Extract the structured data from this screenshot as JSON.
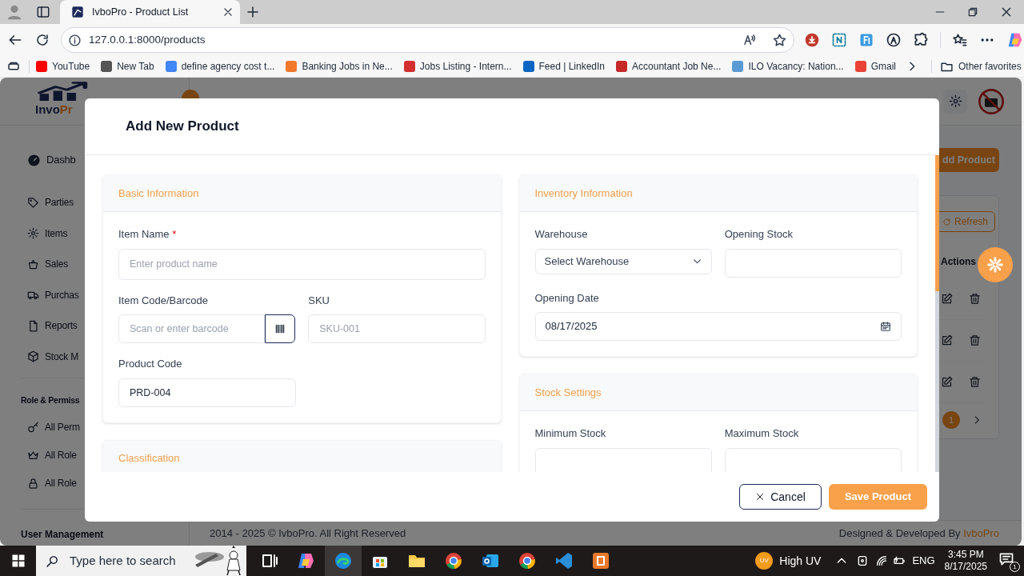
{
  "browser": {
    "tab_title": "IvboPro - Product List",
    "url": "127.0.0.1:8000/products",
    "bookmarks": [
      {
        "label": "YouTube",
        "color": "#ff0000"
      },
      {
        "label": "New Tab",
        "color": "#555555"
      },
      {
        "label": "define agency cost t...",
        "color": "#4285f4"
      },
      {
        "label": "Banking Jobs in Ne...",
        "color": "#f07a2a"
      },
      {
        "label": "Jobs Listing - Intern...",
        "color": "#d32f2f"
      },
      {
        "label": "Feed | LinkedIn",
        "color": "#0a66c2"
      },
      {
        "label": "Accountant Job Ne...",
        "color": "#c62828"
      },
      {
        "label": "ILO Vacancy: Nation...",
        "color": "#5b9bd5"
      },
      {
        "label": "Gmail",
        "color": "#ea4335"
      }
    ],
    "other_favorites": "Other favorites"
  },
  "app": {
    "logo": {
      "dark": "Invo",
      "accent": "Pr"
    },
    "sidebar": {
      "items": [
        "Dashb",
        "Parties",
        "Items",
        "Sales",
        "Purchas",
        "Reports",
        "Stock M"
      ],
      "section": {
        "title": "Role & Permiss",
        "items": [
          "All Perm",
          "All Role",
          "All Role"
        ]
      },
      "next_section": "User Management"
    },
    "add_button": "dd Product",
    "refresh_button": "Refresh",
    "actions_header": "Actions",
    "pagination": [
      {
        "label": "1",
        "selected": true
      }
    ],
    "footer": {
      "copyright": "2014 - 2025 © IvboPro. All Right Reserved",
      "credit": "Designed & Developed By",
      "credit_link": "IvboPro"
    }
  },
  "modal": {
    "title": "Add New Product",
    "basic_information": {
      "title": "Basic Information",
      "item_name": {
        "label": "Item Name",
        "required_mark": "*",
        "placeholder": "Enter product name"
      },
      "item_code": {
        "label": "Item Code/Barcode",
        "placeholder": "Scan or enter barcode"
      },
      "sku": {
        "label": "SKU",
        "placeholder": "SKU-001"
      },
      "product_code": {
        "label": "Product Code",
        "value": "PRD-004"
      }
    },
    "classification": {
      "title": "Classification"
    },
    "inventory_information": {
      "title": "Inventory Information",
      "warehouse": {
        "label": "Warehouse",
        "placeholder": "Select Warehouse"
      },
      "opening_stock": {
        "label": "Opening Stock"
      },
      "opening_date": {
        "label": "Opening Date",
        "value": "08/17/2025"
      }
    },
    "stock_settings": {
      "title": "Stock Settings",
      "minimum_stock": {
        "label": "Minimum Stock"
      },
      "maximum_stock": {
        "label": "Maximum Stock"
      }
    },
    "cancel_button": "Cancel",
    "save_button": "Save Product"
  },
  "taskbar": {
    "search_placeholder": "Type here to search",
    "weather_badge": "UV",
    "weather": "High UV",
    "language": "ENG",
    "time": "3:45 PM",
    "date": "8/17/2025",
    "notifications": "1"
  }
}
